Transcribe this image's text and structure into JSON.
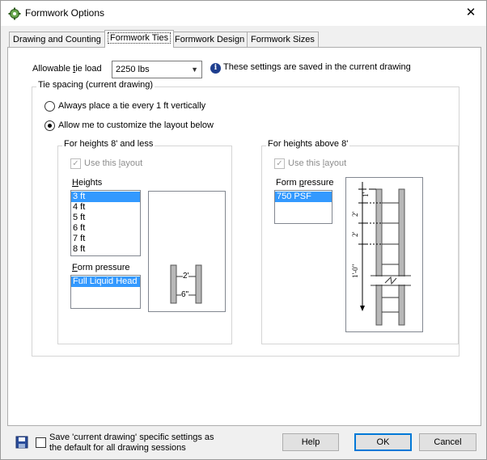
{
  "window": {
    "title": "Formwork Options",
    "close_label": "✕"
  },
  "tabs": [
    {
      "label": "Drawing and Counting",
      "active": false
    },
    {
      "label": "Formwork Ties",
      "active": true
    },
    {
      "label": "Formwork Design",
      "active": false
    },
    {
      "label": "Formwork Sizes",
      "active": false
    }
  ],
  "tie_load": {
    "label_pre": "Allowable ",
    "label_ul": "t",
    "label_post": "ie load",
    "value": "2250 lbs",
    "info_text": "These settings are saved in the current drawing"
  },
  "tie_spacing": {
    "label": "Tie spacing (current drawing)",
    "option1": "Always place a tie every 1 ft vertically",
    "option2": "Allow me to customize the layout below",
    "selected": 2
  },
  "low": {
    "label": "For heights 8' and less",
    "use_layout_pre": "Use this ",
    "use_layout_ul": "l",
    "use_layout_post": "ayout",
    "use_layout_checked": true,
    "heights_ul": "H",
    "heights_post": "eights",
    "heights": [
      "3 ft",
      "4 ft",
      "5 ft",
      "6 ft",
      "7 ft",
      "8 ft"
    ],
    "selected_height": "3 ft",
    "form_pressure_ul": "F",
    "form_pressure_post": "orm pressure",
    "pressure_options": [
      "Full Liquid Head"
    ],
    "diagram_top": "2'",
    "diagram_bottom": "6\""
  },
  "high": {
    "label": "For heights above 8'",
    "use_layout_pre": "Use this ",
    "use_layout_ul": "l",
    "use_layout_post": "ayout",
    "use_layout_checked": true,
    "form_pressure_pre": "Form ",
    "form_pressure_ul": "p",
    "form_pressure_post": "ressure",
    "pressure_options": [
      "750 PSF"
    ],
    "dims": [
      "1'",
      "2'",
      "2'",
      "1'-0\""
    ]
  },
  "footer": {
    "save_default_text_line1": "Save 'current drawing' specific settings as",
    "save_default_text_line2": "the default for all drawing sessions",
    "help_label": "Help",
    "ok_label": "OK",
    "cancel_label": "Cancel"
  },
  "colors": {
    "selection": "#3399ff",
    "default_button_border": "#0078d7",
    "info_icon": "#1f3f8f"
  }
}
